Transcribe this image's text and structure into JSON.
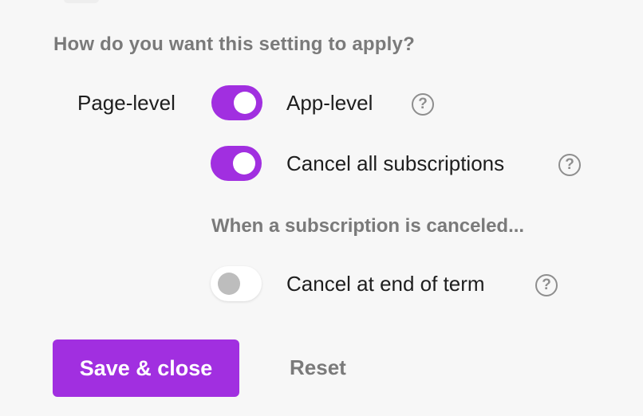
{
  "question": "How do you want this setting to apply?",
  "scope": {
    "left_label": "Page-level",
    "right_label": "App-level",
    "toggle_state": "on",
    "help_glyph": "?"
  },
  "cancel_all": {
    "label": "Cancel all subscriptions",
    "toggle_state": "on",
    "help_glyph": "?"
  },
  "subheading": "When a subscription is canceled...",
  "cancel_end_of_term": {
    "label": "Cancel at end of term",
    "toggle_state": "off",
    "help_glyph": "?"
  },
  "actions": {
    "save_label": "Save & close",
    "reset_label": "Reset"
  },
  "colors": {
    "accent": "#a12fe0",
    "muted_text": "#7a7a7a",
    "background": "#f7f7f7"
  }
}
